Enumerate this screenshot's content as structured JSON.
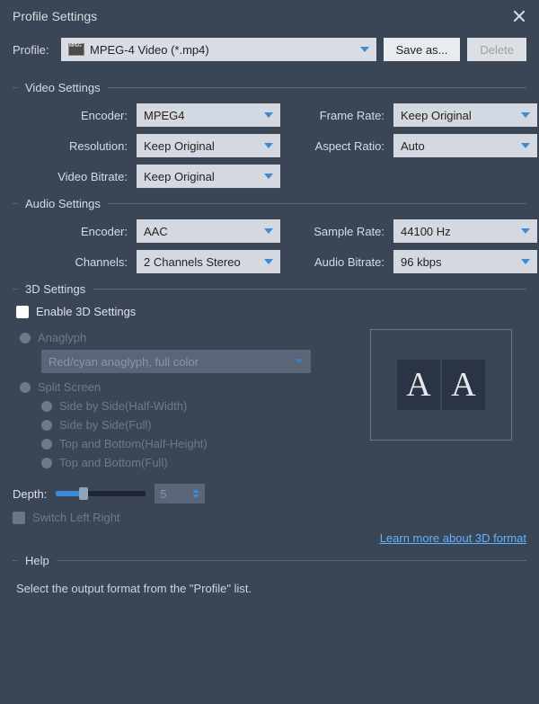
{
  "header": {
    "title": "Profile Settings"
  },
  "profile": {
    "label": "Profile:",
    "value": "MPEG-4 Video (*.mp4)",
    "save_as": "Save as...",
    "delete": "Delete"
  },
  "video": {
    "section": "Video Settings",
    "encoder_label": "Encoder:",
    "encoder": "MPEG4",
    "resolution_label": "Resolution:",
    "resolution": "Keep Original",
    "bitrate_label": "Video Bitrate:",
    "bitrate": "Keep Original",
    "framerate_label": "Frame Rate:",
    "framerate": "Keep Original",
    "aspect_label": "Aspect Ratio:",
    "aspect": "Auto"
  },
  "audio": {
    "section": "Audio Settings",
    "encoder_label": "Encoder:",
    "encoder": "AAC",
    "channels_label": "Channels:",
    "channels": "2 Channels Stereo",
    "samplerate_label": "Sample Rate:",
    "samplerate": "44100 Hz",
    "bitrate_label": "Audio Bitrate:",
    "bitrate": "96 kbps"
  },
  "d3": {
    "section": "3D Settings",
    "enable": "Enable 3D Settings",
    "anaglyph": "Anaglyph",
    "anaglyph_mode": "Red/cyan anaglyph, full color",
    "split_screen": "Split Screen",
    "sbs_half": "Side by Side(Half-Width)",
    "sbs_full": "Side by Side(Full)",
    "tab_half": "Top and Bottom(Half-Height)",
    "tab_full": "Top and Bottom(Full)",
    "depth_label": "Depth:",
    "depth_value": "5",
    "switch_lr": "Switch Left Right",
    "learn_more": "Learn more about 3D format",
    "preview_a": "A",
    "preview_b": "A"
  },
  "help": {
    "section": "Help",
    "text": "Select the output format from the \"Profile\" list."
  }
}
